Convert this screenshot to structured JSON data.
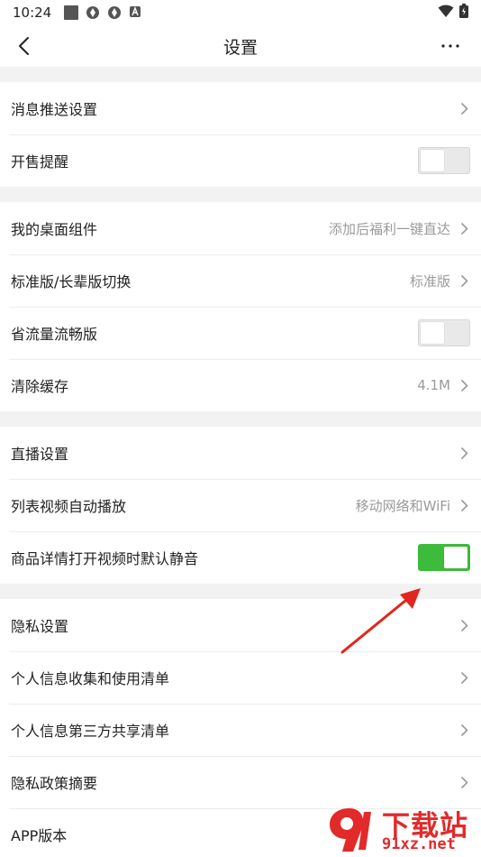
{
  "status_bar": {
    "time": "10:24"
  },
  "header": {
    "title": "设置"
  },
  "sections": [
    {
      "rows": [
        {
          "label": "消息推送设置",
          "value": "",
          "control": "chevron"
        },
        {
          "label": "开售提醒",
          "value": "",
          "control": "toggle",
          "on": false
        }
      ]
    },
    {
      "rows": [
        {
          "label": "我的桌面组件",
          "value": "添加后福利一键直达",
          "control": "chevron"
        },
        {
          "label": "标准版/长辈版切换",
          "value": "标准版",
          "control": "chevron"
        },
        {
          "label": "省流量流畅版",
          "value": "",
          "control": "toggle",
          "on": false
        },
        {
          "label": "清除缓存",
          "value": "4.1M",
          "control": "chevron"
        }
      ]
    },
    {
      "rows": [
        {
          "label": "直播设置",
          "value": "",
          "control": "chevron"
        },
        {
          "label": "列表视频自动播放",
          "value": "移动网络和WiFi",
          "control": "chevron"
        },
        {
          "label": "商品详情打开视频时默认静音",
          "value": "",
          "control": "toggle",
          "on": true
        }
      ]
    },
    {
      "rows": [
        {
          "label": "隐私设置",
          "value": "",
          "control": "chevron"
        },
        {
          "label": "个人信息收集和使用清单",
          "value": "",
          "control": "chevron"
        },
        {
          "label": "个人信息第三方共享清单",
          "value": "",
          "control": "chevron"
        },
        {
          "label": "隐私政策摘要",
          "value": "",
          "control": "chevron"
        },
        {
          "label": "APP版本",
          "value": "",
          "control": "none"
        }
      ]
    }
  ],
  "watermark": {
    "brand": "下载站",
    "domain": "91xz.net"
  },
  "colors": {
    "toggle_on": "#3dbb3b",
    "toggle_off": "#e9e9e9",
    "section_gap": "#f2f2f2",
    "annotation_arrow": "#e0261e",
    "watermark": "#e22a2a"
  },
  "icons": [
    "back-arrow-icon",
    "more-dots-icon",
    "chevron-right-icon",
    "wifi-icon",
    "battery-icon",
    "red-annotation-arrow"
  ]
}
